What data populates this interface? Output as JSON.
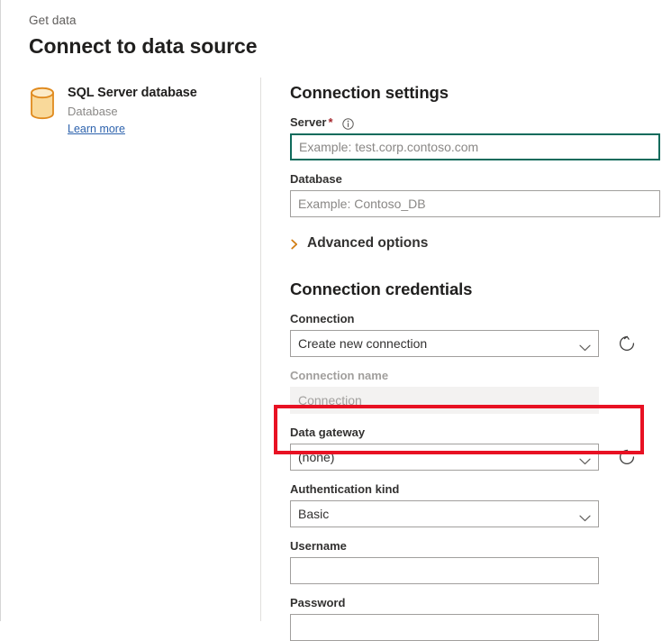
{
  "header": {
    "breadcrumb": "Get data",
    "title": "Connect to data source"
  },
  "source": {
    "icon": "database-cylinder-icon",
    "name": "SQL Server database",
    "category": "Database",
    "link_label": "Learn more"
  },
  "connection_settings": {
    "section_title": "Connection settings",
    "server": {
      "label": "Server",
      "required_marker": "*",
      "info_icon": "info-circle-icon",
      "placeholder": "Example: test.corp.contoso.com",
      "value": "",
      "focused": true
    },
    "database": {
      "label": "Database",
      "placeholder": "Example: Contoso_DB",
      "value": ""
    },
    "advanced_options": {
      "label": "Advanced options",
      "chevron_icon": "chevron-right-icon",
      "expanded": false
    }
  },
  "connection_credentials": {
    "section_title": "Connection credentials",
    "connection": {
      "label": "Connection",
      "value": "Create new connection",
      "chevron_icon": "chevron-down-icon",
      "refresh_icon": "refresh-icon"
    },
    "connection_name": {
      "label": "Connection name",
      "placeholder": "Connection",
      "value": "",
      "disabled": true
    },
    "data_gateway": {
      "label": "Data gateway",
      "value": "(none)",
      "chevron_icon": "chevron-down-icon",
      "refresh_icon": "refresh-icon",
      "highlighted": true
    },
    "authentication_kind": {
      "label": "Authentication kind",
      "value": "Basic",
      "chevron_icon": "chevron-down-icon"
    },
    "username": {
      "label": "Username",
      "placeholder": "",
      "value": ""
    },
    "password": {
      "label": "Password",
      "placeholder": "",
      "value": ""
    }
  },
  "colors": {
    "focus_border": "#0f6b5c",
    "highlight": "#e81123",
    "link": "#2e63ad",
    "required_star": "#a4262c",
    "accent_chevron": "#d17b0f",
    "icon_fill": "#f7d186",
    "icon_stroke": "#d98f1a"
  }
}
